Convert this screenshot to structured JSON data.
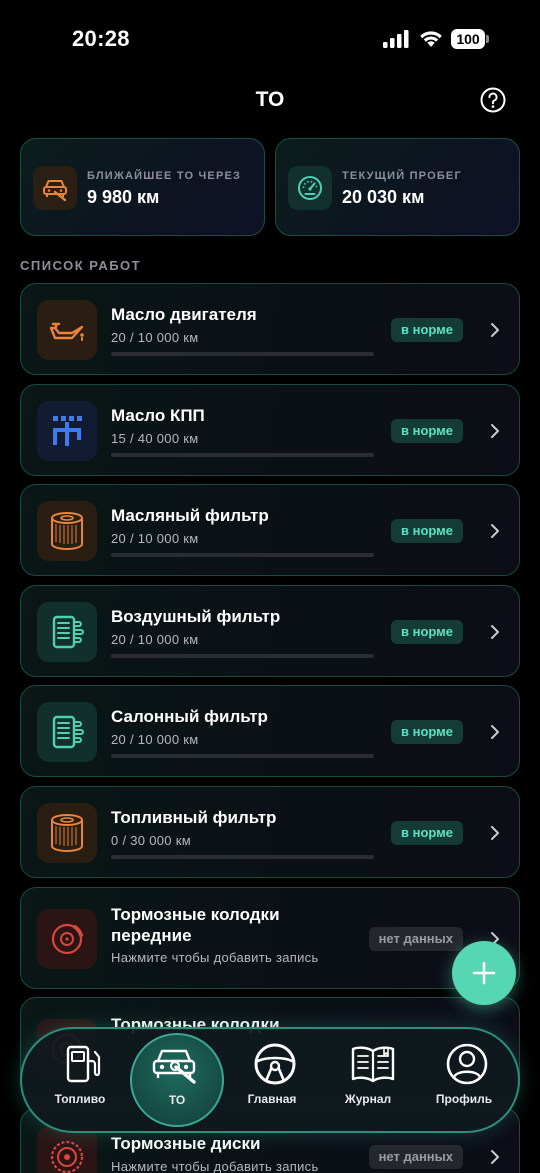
{
  "status_bar": {
    "time": "20:28",
    "battery": "100"
  },
  "header": {
    "title": "ТО"
  },
  "summary": {
    "nearest": {
      "label": "БЛИЖАЙШЕЕ ТО ЧЕРЕЗ",
      "value": "9 980 км"
    },
    "mileage": {
      "label": "ТЕКУЩИЙ ПРОБЕГ",
      "value": "20 030 км"
    }
  },
  "section_title": "СПИСОК РАБОТ",
  "works": [
    {
      "title": "Масло двигателя",
      "sub": "20 / 10 000 км",
      "status": "в норме"
    },
    {
      "title": "Масло КПП",
      "sub": "15 / 40 000 км",
      "status": "в норме"
    },
    {
      "title": "Масляный фильтр",
      "sub": "20 / 10 000 км",
      "status": "в норме"
    },
    {
      "title": "Воздушный фильтр",
      "sub": "20 / 10 000 км",
      "status": "в норме"
    },
    {
      "title": "Салонный фильтр",
      "sub": "20 / 10 000 км",
      "status": "в норме"
    },
    {
      "title": "Топливный фильтр",
      "sub": "0 / 30 000 км",
      "status": "в норме"
    },
    {
      "title_line1": "Тормозные колодки",
      "title_line2": "передние",
      "sub": "Нажмите чтобы добавить запись",
      "status": "нет данных"
    },
    {
      "title_line1": "Тормозные колодки"
    },
    {
      "title": "Тормозные диски",
      "sub": "Нажмите чтобы добавить запись",
      "status": "нет данных"
    }
  ],
  "nav": [
    {
      "label": "Топливо"
    },
    {
      "label": "ТО"
    },
    {
      "label": "Главная"
    },
    {
      "label": "Журнал"
    },
    {
      "label": "Профиль"
    }
  ],
  "colors": {
    "accent": "#56d6b1",
    "icon_orange": "#e8853a",
    "icon_blue": "#3f7bf0",
    "icon_teal": "#4fd1b0",
    "icon_red": "#d9463e"
  }
}
